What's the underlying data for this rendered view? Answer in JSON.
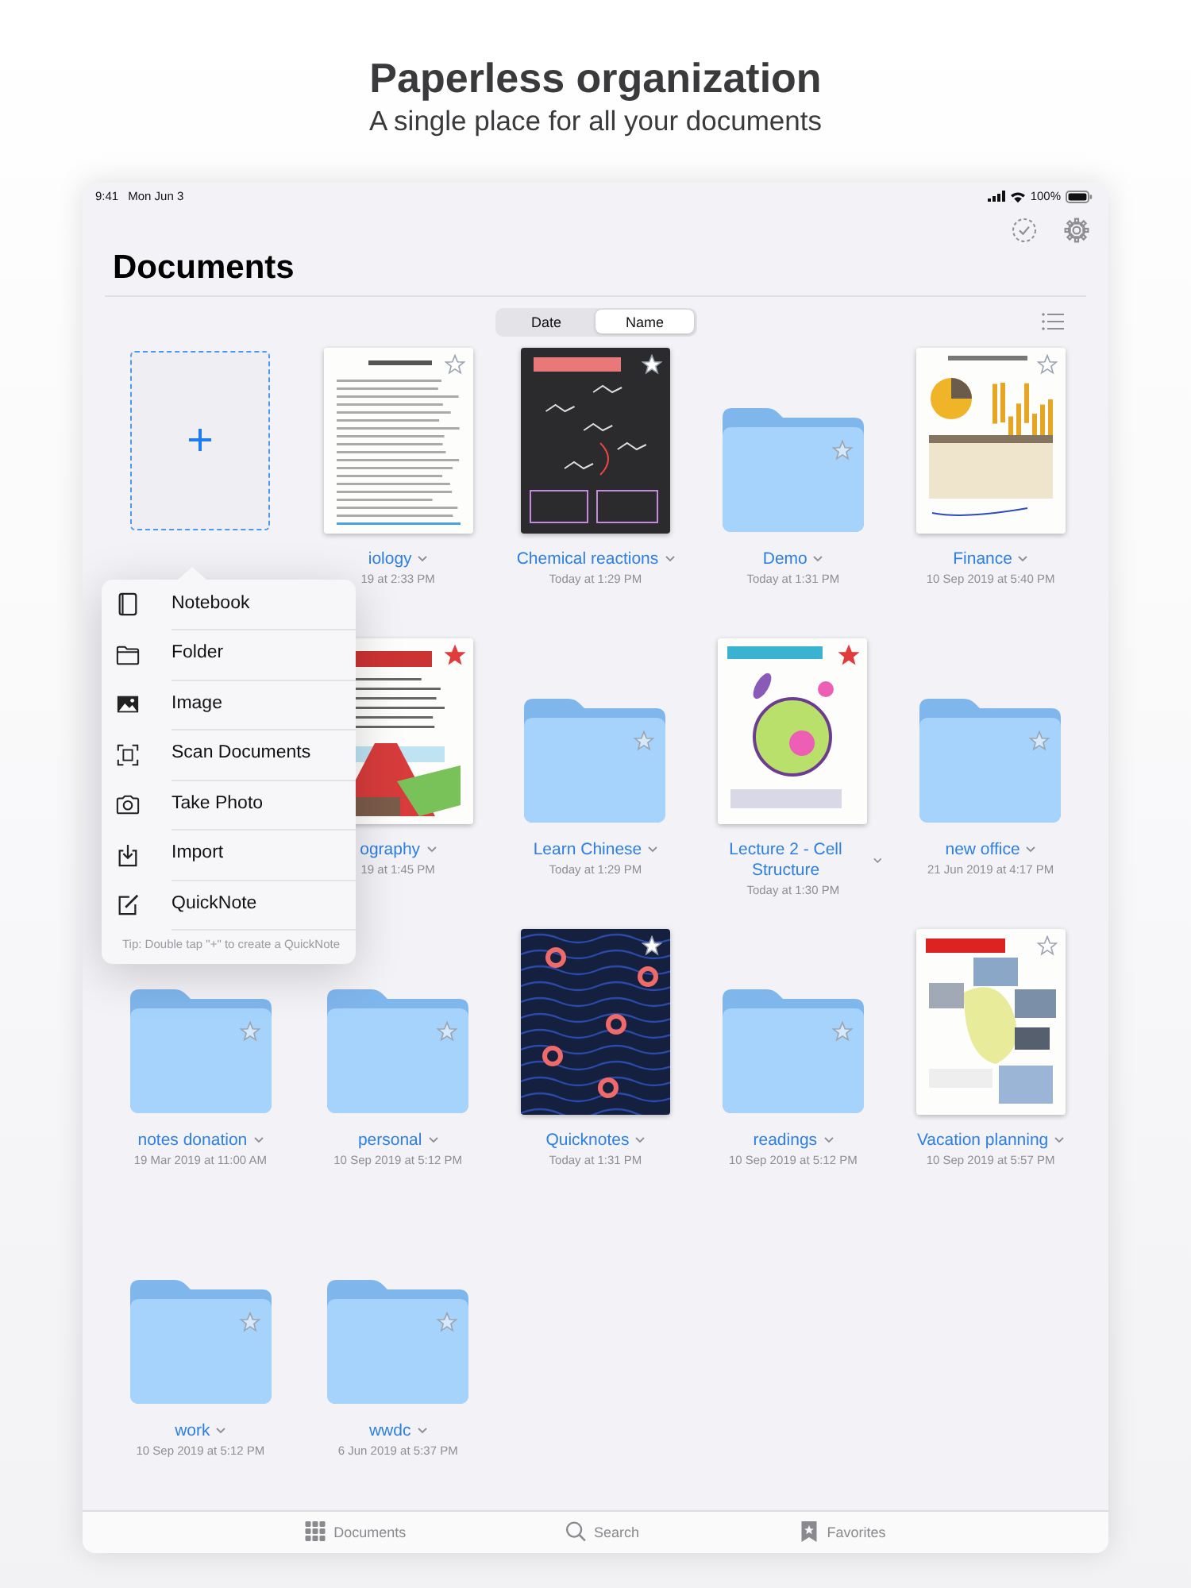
{
  "promo": {
    "headline": "Paperless organization",
    "subline": "A single place for all your documents"
  },
  "status_bar": {
    "time": "9:41",
    "date": "Mon Jun 3",
    "battery": "100%"
  },
  "title": "Documents",
  "sort_tabs": [
    {
      "label": "Date",
      "selected": false
    },
    {
      "label": "Name",
      "selected": true
    }
  ],
  "items": [
    {
      "kind": "new"
    },
    {
      "kind": "document",
      "name": "iology",
      "date": "19 at 2:33 PM",
      "favorite": false
    },
    {
      "kind": "document",
      "name": "Chemical reactions",
      "date": "Today at 1:29 PM",
      "favorite": false
    },
    {
      "kind": "folder",
      "name": "Demo",
      "date": "Today at 1:31 PM"
    },
    {
      "kind": "document",
      "name": "Finance",
      "date": "10 Sep 2019 at 5:40 PM",
      "favorite": false
    },
    {
      "kind": "document",
      "name": "ography",
      "date": "19 at 1:45 PM",
      "favorite": true
    },
    {
      "kind": "folder",
      "name": "Learn Chinese",
      "date": "Today at 1:29 PM"
    },
    {
      "kind": "document",
      "name": "Lecture 2 - Cell Structure",
      "date": "Today at 1:30 PM",
      "favorite": true
    },
    {
      "kind": "folder",
      "name": "new office",
      "date": "21 Jun 2019 at 4:17 PM"
    },
    {
      "kind": "folder",
      "name": "notes donation",
      "date": "19 Mar 2019 at 11:00 AM"
    },
    {
      "kind": "folder",
      "name": "personal",
      "date": "10 Sep 2019 at 5:12 PM"
    },
    {
      "kind": "document",
      "name": "Quicknotes",
      "date": "Today at 1:31 PM",
      "favorite": false
    },
    {
      "kind": "folder",
      "name": "readings",
      "date": "10 Sep 2019 at 5:12 PM"
    },
    {
      "kind": "document",
      "name": "Vacation planning",
      "date": "10 Sep 2019 at 5:57 PM",
      "favorite": false
    },
    {
      "kind": "folder",
      "name": "work",
      "date": "10 Sep 2019 at 5:12 PM"
    },
    {
      "kind": "folder",
      "name": "wwdc",
      "date": "6 Jun 2019 at 5:37 PM"
    }
  ],
  "new_menu": {
    "items": [
      "Notebook",
      "Folder",
      "Image",
      "Scan Documents",
      "Take Photo",
      "Import",
      "QuickNote"
    ],
    "tip": "Tip: Double tap \"+\" to create a QuickNote"
  },
  "tab_bar": [
    {
      "label": "Documents"
    },
    {
      "label": "Search"
    },
    {
      "label": "Favorites"
    }
  ]
}
